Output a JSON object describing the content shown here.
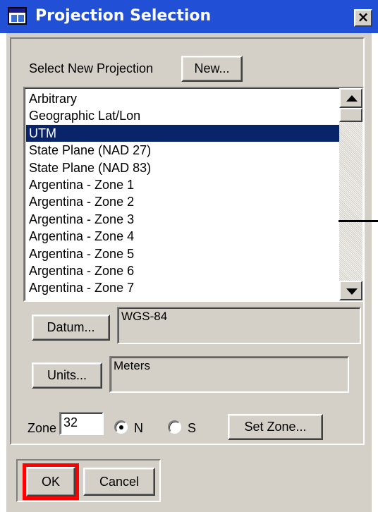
{
  "window": {
    "title": "Projection Selection",
    "close_label": "×"
  },
  "select_projection": {
    "label": "Select New Projection",
    "new_button": "New..."
  },
  "projection_list": {
    "items": [
      "Arbitrary",
      "Geographic Lat/Lon",
      "UTM",
      "State Plane (NAD 27)",
      "State Plane (NAD 83)",
      "Argentina - Zone 1",
      "Argentina - Zone 2",
      "Argentina - Zone 3",
      "Argentina - Zone 4",
      "Argentina - Zone 5",
      "Argentina - Zone 6",
      "Argentina - Zone 7"
    ],
    "selected_index": 2
  },
  "datum": {
    "button": "Datum...",
    "value": "WGS-84"
  },
  "units": {
    "button": "Units...",
    "value": "Meters"
  },
  "zone": {
    "label": "Zone",
    "value": "32",
    "north_label": "N",
    "south_label": "S",
    "hemisphere": "N",
    "set_zone_button": "Set Zone..."
  },
  "actions": {
    "ok": "OK",
    "cancel": "Cancel"
  },
  "colors": {
    "titlebar": "#2150d6",
    "selection": "#0a246a",
    "dialog_face": "#d4d0c8",
    "highlight_box": "#ff0000"
  },
  "icons": {
    "window_icon": "dialog-icon",
    "close": "close-icon",
    "scroll_up": "arrow-up-icon",
    "scroll_down": "arrow-down-icon"
  }
}
